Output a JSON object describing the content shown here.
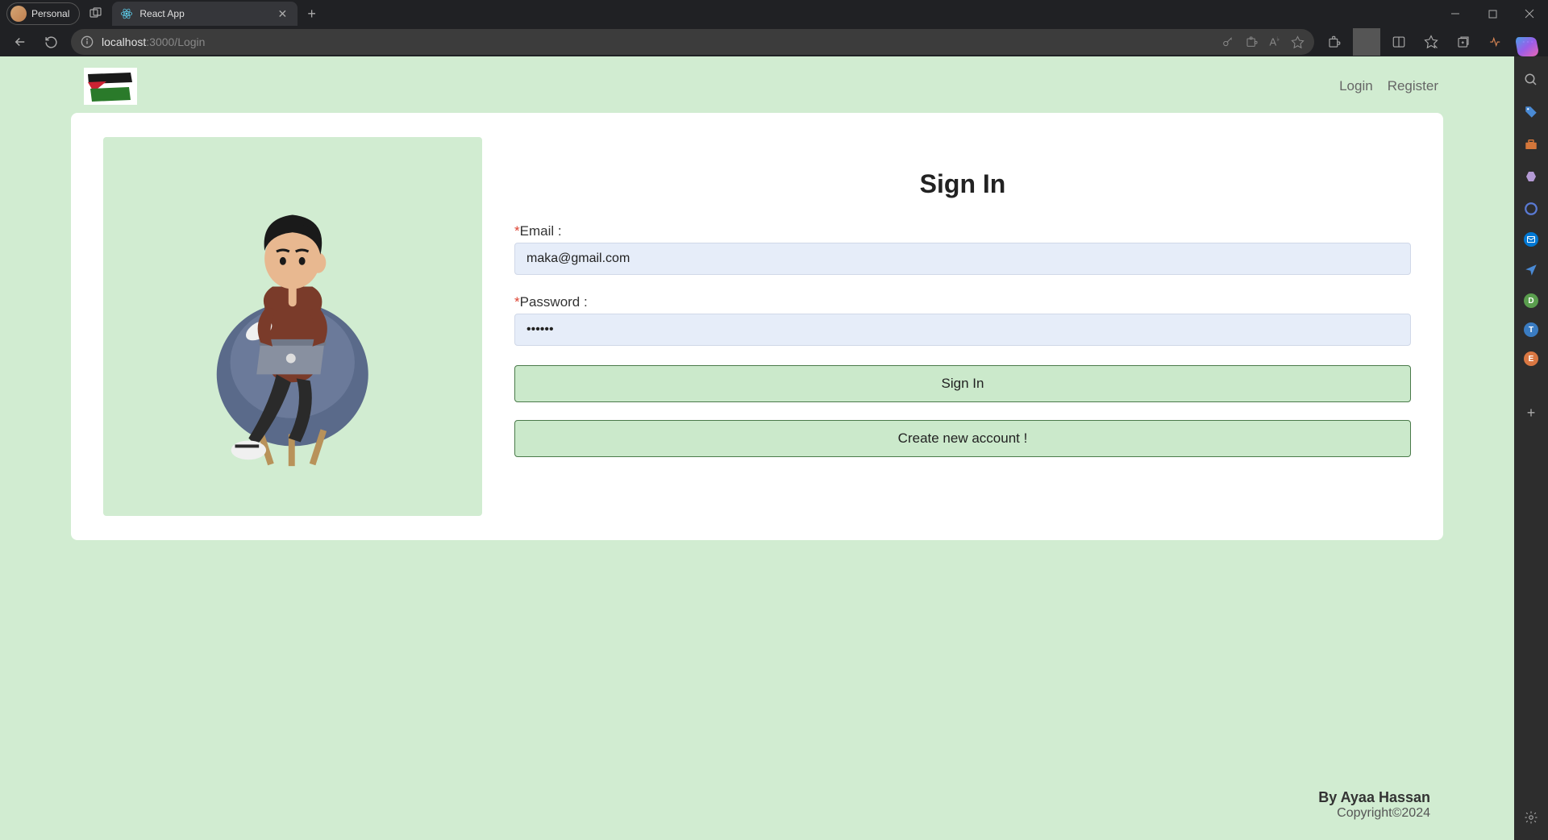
{
  "browser": {
    "profile_label": "Personal",
    "tab_title": "React App",
    "url_host": "localhost",
    "url_path": ":3000/Login"
  },
  "header": {
    "nav": {
      "login": "Login",
      "register": "Register"
    }
  },
  "form": {
    "title": "Sign In",
    "email_label": "Email :",
    "email_value": "maka@gmail.com",
    "password_label": "Password :",
    "password_value": "••••••",
    "signin_btn": "Sign In",
    "create_btn": "Create new account !"
  },
  "footer": {
    "by": "By Ayaa Hassan",
    "copyright": "Copyright©2024"
  },
  "sidebar_bubbles": {
    "d": "D",
    "t": "T",
    "e": "E"
  }
}
